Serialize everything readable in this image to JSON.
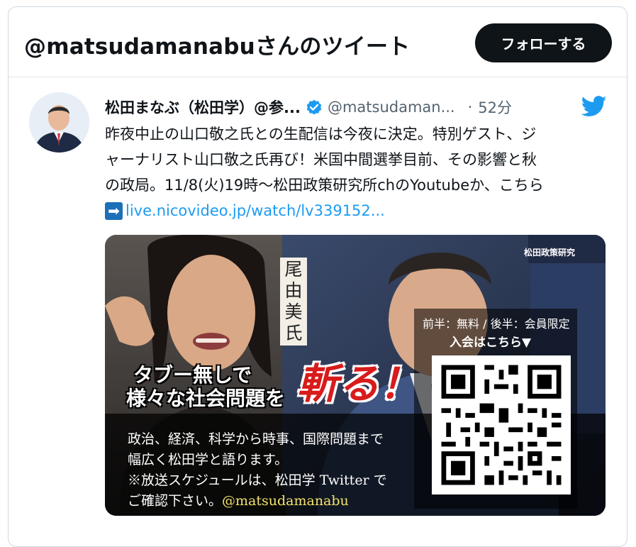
{
  "header": {
    "title": "@matsudamanabuさんのツイート",
    "follow_label": "フォローする"
  },
  "tweet": {
    "author_name": "松田まなぶ（松田学）@参...",
    "handle": "@matsudaman...",
    "separator": "·",
    "time": "52分",
    "text_lines": [
      "昨夜中止の山口敬之氏との生配信は今夜に決定。特別ゲスト、ジ",
      "ャーナリスト山口敬之氏再び！米国中間選挙目前、その影響と秋",
      "の政局。11/8(火)19時〜松田政策研究所chのYoutubeか、こちら"
    ],
    "link_arrow": "➡",
    "link_text": "live.nicovideo.jp/watch/lv339152..."
  },
  "media": {
    "name_vertical": "尾由美氏",
    "caption_line1": "タブー無しで",
    "caption_line2": "様々な社会問題を",
    "slash_text": "斬る！",
    "band_lines": [
      "政治、経済、科学から時事、国際問題まで",
      "幅広く松田学と語ります。",
      "※放送スケジュールは、松田学 Twitter で"
    ],
    "band_last_prefix": "ご確認下さい。",
    "band_handle": "@matsudamanabu",
    "qr_line1": "前半：無料 / 後半：会員限定",
    "qr_line2": "入会はこちら▼",
    "corner_logo": "松田政策研究"
  },
  "colors": {
    "accent": "#1d9bf0",
    "text": "#0f1419",
    "secondary": "#536471",
    "button_bg": "#0f1419"
  },
  "icons": {
    "verified": "verified-badge-icon",
    "twitter": "twitter-bird-icon",
    "arrow": "right-arrow-emoji-icon"
  }
}
